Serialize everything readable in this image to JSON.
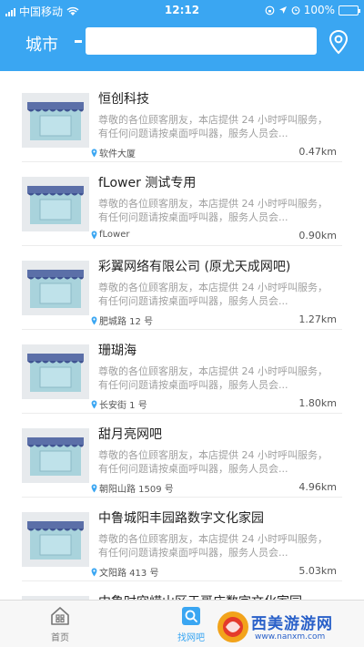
{
  "statusbar": {
    "carrier": "中国移动",
    "time": "12:12",
    "battery": "100%",
    "battery_level": 1.0
  },
  "header": {
    "city_label": "城市",
    "search_value": ""
  },
  "stores": [
    {
      "name": "恒创科技",
      "desc": "尊敬的各位顾客朋友，本店提供 24 小时呼叫服务，有任何问题请按桌面呼叫器，服务人员会...",
      "address": "软件大厦",
      "distance": "0.47km"
    },
    {
      "name": "fLower 测试专用",
      "desc": "尊敬的各位顾客朋友，本店提供 24 小时呼叫服务，有任何问题请按桌面呼叫器，服务人员会...",
      "address": "fLower",
      "distance": "0.90km"
    },
    {
      "name": "彩翼网络有限公司 (原尤天成网吧)",
      "desc": "尊敬的各位顾客朋友，本店提供 24 小时呼叫服务，有任何问题请按桌面呼叫器，服务人员会...",
      "address": "肥城路 12 号",
      "distance": "1.27km"
    },
    {
      "name": "珊瑚海",
      "desc": "尊敬的各位顾客朋友，本店提供 24 小时呼叫服务，有任何问题请按桌面呼叫器，服务人员会...",
      "address": "长安街 1 号",
      "distance": "1.80km"
    },
    {
      "name": "甜月亮网吧",
      "desc": "尊敬的各位顾客朋友，本店提供 24 小时呼叫服务，有任何问题请按桌面呼叫器，服务人员会...",
      "address": "朝阳山路 1509 号",
      "distance": "4.96km"
    },
    {
      "name": "中鲁城阳丰园路数字文化家园",
      "desc": "尊敬的各位顾客朋友，本店提供 24 小时呼叫服务，有任何问题请按桌面呼叫器，服务人员会...",
      "address": "文阳路 413 号",
      "distance": "5.03km"
    },
    {
      "name": "中鲁时空崂山区于哥庄数字文化家园",
      "desc": "",
      "address": "",
      "distance": ""
    }
  ],
  "tabbar": {
    "home_label": "首页",
    "find_label": "找网吧"
  },
  "watermark": {
    "text": "西美游游网",
    "url": "www.nanxm.com"
  },
  "colors": {
    "primary": "#3aa6f2",
    "thumb_awning": "#5b6fa8",
    "thumb_window": "#a9d3dc"
  },
  "icons": {
    "header_location": "location-pin-icon",
    "address_pin": "pin-icon",
    "home_tab": "home-grid-icon",
    "find_tab": "search-store-icon"
  }
}
